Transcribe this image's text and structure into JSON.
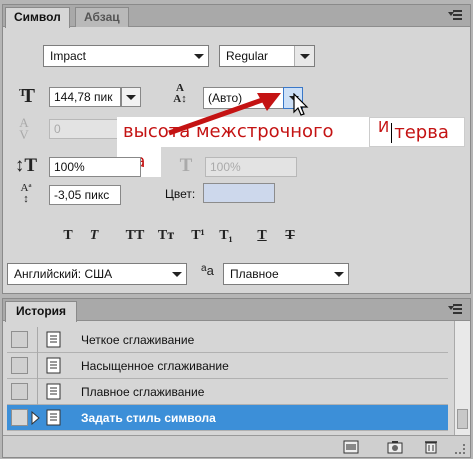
{
  "character_panel": {
    "tabs": [
      "Символ",
      "Абзац"
    ],
    "font_family": "Impact",
    "font_style": "Regular",
    "font_size": "144,78 пик",
    "leading": "(Авто)",
    "kerning": "0",
    "tracking": "",
    "vertical_scale": "100%",
    "horizontal_scale": "100%",
    "baseline_shift": "-3,05 пикс",
    "color_label": "Цвет:",
    "color_value": "#cdd8ec",
    "language": "Английский: США",
    "antialias_label": "a",
    "antialias_value": "Плавное",
    "annotation": {
      "line1": "высота межстрочного",
      "line1b": "И",
      "line1c": "терва",
      "line2": "ла",
      "color": "#c41313"
    },
    "format_buttons": [
      "T",
      "T",
      "TT",
      "Tт",
      "T¹",
      "T₁",
      "T",
      "T"
    ]
  },
  "history_panel": {
    "tab": "История",
    "items": [
      {
        "label": "Четкое сглаживание",
        "selected": false
      },
      {
        "label": "Насыщенное сглаживание",
        "selected": false
      },
      {
        "label": "Плавное сглаживание",
        "selected": false
      },
      {
        "label": "Задать стиль символа",
        "selected": true
      }
    ],
    "selection_color": "#3c8fd8"
  }
}
